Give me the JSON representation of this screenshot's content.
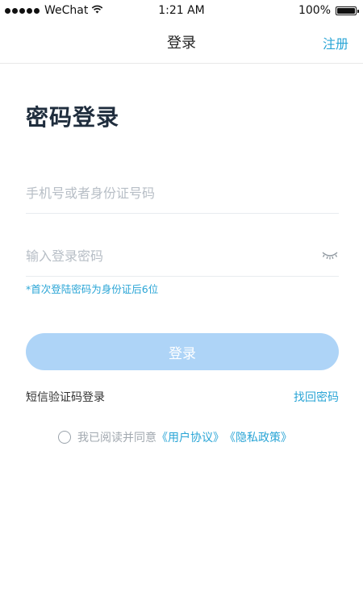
{
  "status_bar": {
    "carrier": "WeChat",
    "time": "1:21 AM",
    "battery_text": "100%",
    "battery_level": 1.0,
    "icons": [
      "signal-dots-icon",
      "wifi-icon",
      "battery-icon"
    ]
  },
  "nav": {
    "title": "登录",
    "register_label": "注册"
  },
  "page": {
    "title": "密码登录"
  },
  "form": {
    "phone_placeholder": "手机号或者身份证号码",
    "password_placeholder": "输入登录密码",
    "password_hint": "*首次登陆密码为身份证后6位",
    "login_button_label": "登录",
    "eye_icon": "eye-closed-icon"
  },
  "links": {
    "sms_login": "短信验证码登录",
    "forgot_password": "找回密码"
  },
  "agreement": {
    "prefix": "我已阅读并同意",
    "user_agreement": "《用户协议》",
    "privacy_policy": "《隐私政策》",
    "checked": false
  },
  "colors": {
    "accent": "#2aa5d6",
    "button_disabled": "#aed4f7",
    "title": "#1f2d3d",
    "placeholder": "#b7bec6"
  }
}
